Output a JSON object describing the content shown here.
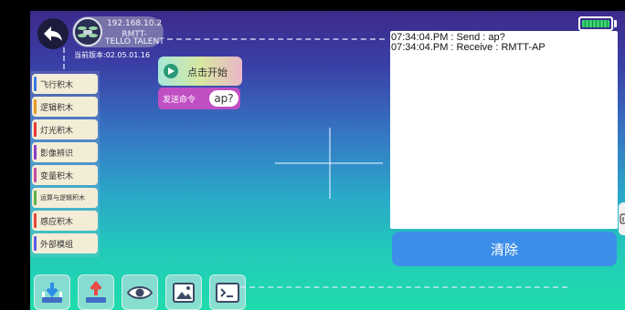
{
  "device": {
    "ip": "192.168.10.2",
    "name_line1": "RMTT-",
    "name_line2": "TELLO TALENT",
    "firmware": "当前版本:02.05.01.16"
  },
  "battery": {
    "level": 1.0,
    "color": "#36d26e"
  },
  "categories": [
    {
      "label": "飞行积木",
      "color": "#3d79e6"
    },
    {
      "label": "逻辑积木",
      "color": "#e59a2b"
    },
    {
      "label": "灯光积木",
      "color": "#e83a3a"
    },
    {
      "label": "影像辨识",
      "color": "#8b3cc6"
    },
    {
      "label": "变量积木",
      "color": "#c64aa6"
    },
    {
      "label": "运算与逻辑积木",
      "color": "#5fb04a"
    },
    {
      "label": "感应积木",
      "color": "#e8483a"
    },
    {
      "label": "外部模组",
      "color": "#5c5ce6"
    }
  ],
  "blocks": {
    "start_label": "点击开始",
    "send_label": "发送命令",
    "send_value": "ap?"
  },
  "log": {
    "lines": [
      "07:34:04.PM : Send : ap?",
      "07:34:04.PM : Receive : RMTT-AP"
    ]
  },
  "clear_label": "清除",
  "toolbar": [
    {
      "name": "download-icon"
    },
    {
      "name": "upload-icon"
    },
    {
      "name": "eye-icon"
    },
    {
      "name": "image-icon"
    },
    {
      "name": "terminal-icon"
    }
  ]
}
